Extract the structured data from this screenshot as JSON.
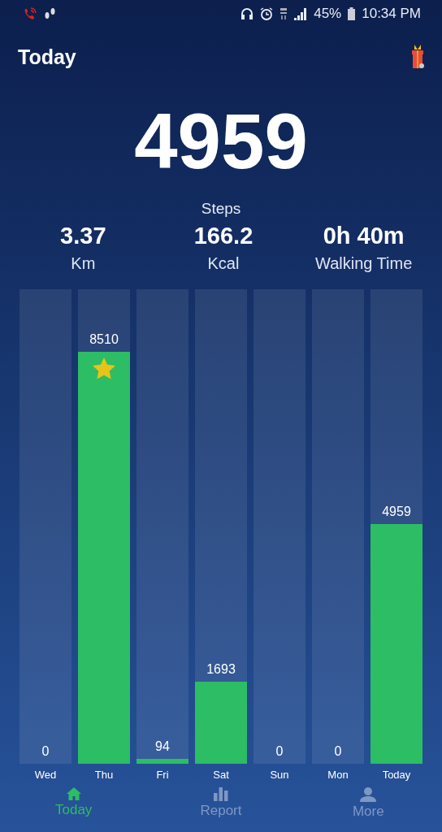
{
  "status_bar": {
    "battery": "45%",
    "time": "10:34 PM"
  },
  "header": {
    "title": "Today"
  },
  "summary": {
    "steps": "4959",
    "steps_label": "Steps"
  },
  "stats": [
    {
      "value": "3.37",
      "label": "Km"
    },
    {
      "value": "166.2",
      "label": "Kcal"
    },
    {
      "value": "0h 40m",
      "label": "Walking Time"
    }
  ],
  "days": [
    {
      "label": "Wed",
      "value": "0",
      "goal_reached": false
    },
    {
      "label": "Thu",
      "value": "8510",
      "level": 0.868,
      "goal_reached": true
    },
    {
      "label": "Fri",
      "value": "94",
      "level": 0.01,
      "goal_reached": false
    },
    {
      "label": "Sat",
      "value": "1693",
      "level": 0.173,
      "goal_reached": false
    },
    {
      "label": "Sun",
      "value": "0",
      "goal_reached": false
    },
    {
      "label": "Mon",
      "value": "0",
      "goal_reached": false
    },
    {
      "label": "Today",
      "value": "4959",
      "level": 0.506,
      "goal_reached": false
    }
  ],
  "nav": [
    {
      "label": "Today",
      "selected": true,
      "kind": "home"
    },
    {
      "label": "Report",
      "selected": false,
      "kind": "report"
    },
    {
      "label": "More",
      "selected": false,
      "kind": "more"
    }
  ]
}
